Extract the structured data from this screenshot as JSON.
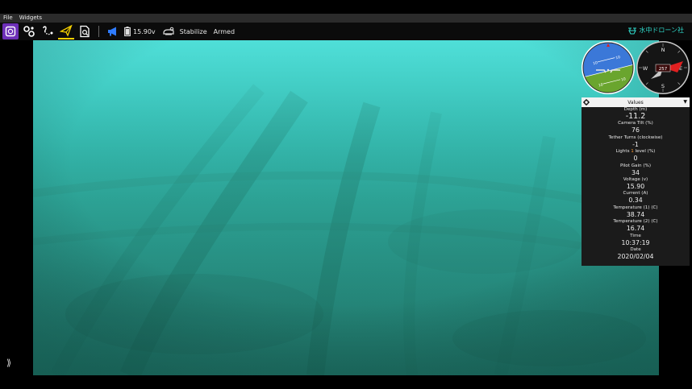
{
  "menubar": {
    "file": "File",
    "widgets": "Widgets"
  },
  "toolbar": {
    "voltage": "15.90v",
    "mode": "Stabilize",
    "armed": "Armed",
    "brand": "水中ドローン社",
    "icons": [
      "menu-icon",
      "vehicle-setup-icon",
      "plan-view-icon",
      "fly-view-icon",
      "analyze-icon",
      "megaphone-icon",
      "battery-icon",
      "rov-icon"
    ]
  },
  "instruments": {
    "attitude_marks": [
      "10",
      "10",
      "10",
      "10"
    ],
    "compass": {
      "heading": "257",
      "n": "N",
      "e": "E",
      "s": "S",
      "w": "W"
    }
  },
  "values_widget": {
    "title": "Values",
    "items": [
      {
        "label": "Depth (m)",
        "value": "-11.2"
      },
      {
        "label": "Camera Tilt (%)",
        "value": "76"
      },
      {
        "label": "Tether Turns (clockwise)",
        "value": "-1"
      },
      {
        "label_pre": "Lights ",
        "label_hl": "1",
        "label_post": " level (%)",
        "value": "0"
      },
      {
        "label": "Pilot Gain (%)",
        "value": "34"
      },
      {
        "label": "Voltage (v)",
        "value": "15.90"
      },
      {
        "label": "Current (A)",
        "value": "0.34"
      },
      {
        "label": "Temperature (1) (C)",
        "value": "38.74"
      },
      {
        "label": "Temperature (2) (C)",
        "value": "16.74"
      },
      {
        "label": "Time",
        "value": "10:37:19"
      },
      {
        "label": "Date",
        "value": "2020/02/04"
      }
    ]
  },
  "expand_glyph": "⟫"
}
